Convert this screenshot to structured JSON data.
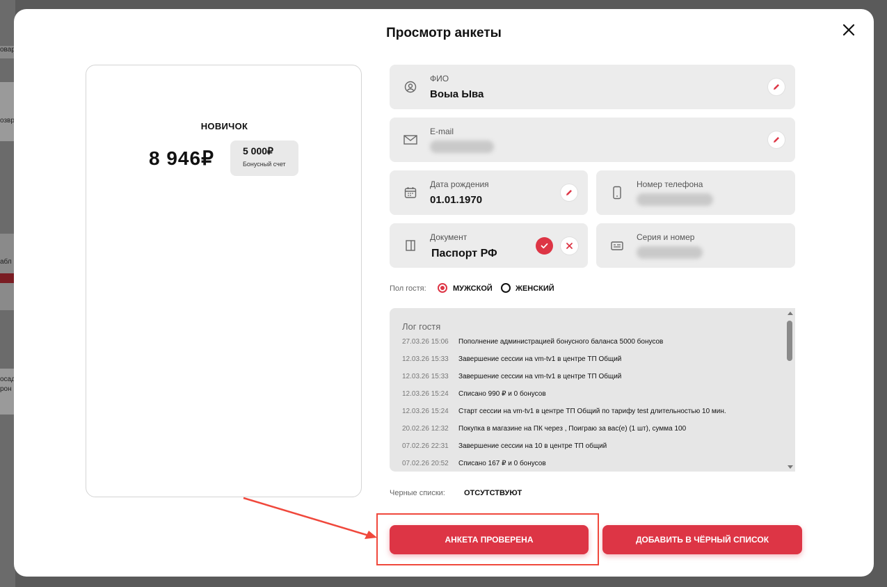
{
  "background": {
    "rows": [
      "овар",
      "озвр",
      "абл",
      "осад",
      "рон"
    ]
  },
  "modal": {
    "title": "Просмотр анкеты",
    "close_icon": "close-icon"
  },
  "card": {
    "level": "НОВИЧОК",
    "balance": "8 946₽",
    "bonus_value": "5 000₽",
    "bonus_label": "Бонусный счет"
  },
  "fields": {
    "fio": {
      "label": "ФИО",
      "value": "Воыа Ыва"
    },
    "email": {
      "label": "E-mail"
    },
    "birth": {
      "label": "Дата рождения",
      "value": "01.01.1970"
    },
    "phone": {
      "label": "Номер телефона"
    },
    "document": {
      "label": "Документ",
      "value": "Паспорт РФ"
    },
    "series": {
      "label": "Серия и номер"
    }
  },
  "gender": {
    "label": "Пол гостя:",
    "male": "МУЖСКОЙ",
    "female": "ЖЕНСКИЙ",
    "selected": "male"
  },
  "log": {
    "title": "Лог гостя",
    "entries": [
      {
        "time": "27.03.26 15:06",
        "text": "Пополнение администрацией бонусного баланса 5000 бонусов"
      },
      {
        "time": "12.03.26 15:33",
        "text": "Завершение сессии на vm-tv1 в центре ТП Общий"
      },
      {
        "time": "12.03.26 15:33",
        "text": "Завершение сессии на vm-tv1 в центре ТП Общий"
      },
      {
        "time": "12.03.26 15:24",
        "text": "Списано 990 ₽ и 0 бонусов"
      },
      {
        "time": "12.03.26 15:24",
        "text": "Старт сессии на vm-tv1 в центре ТП Общий по тарифу test длительностью 10 мин."
      },
      {
        "time": "20.02.26 12:32",
        "text": "Покупка в магазине на ПК через , Поиграю за вас(е) (1 шт), сумма 100"
      },
      {
        "time": "07.02.26 22:31",
        "text": "Завершение сессии на 10 в центре ТП общий"
      },
      {
        "time": "07.02.26 20:52",
        "text": "Списано 167 ₽ и 0 бонусов"
      }
    ]
  },
  "blacklist": {
    "label": "Черные списки:",
    "value": "ОТСУТСТВУЮТ"
  },
  "buttons": {
    "verified": "АНКЕТА ПРОВЕРЕНА",
    "add_blacklist": "ДОБАВИТЬ В ЧЁРНЫЙ СПИСОК"
  },
  "colors": {
    "accent": "#dd3545",
    "annotation": "#f0483c"
  }
}
